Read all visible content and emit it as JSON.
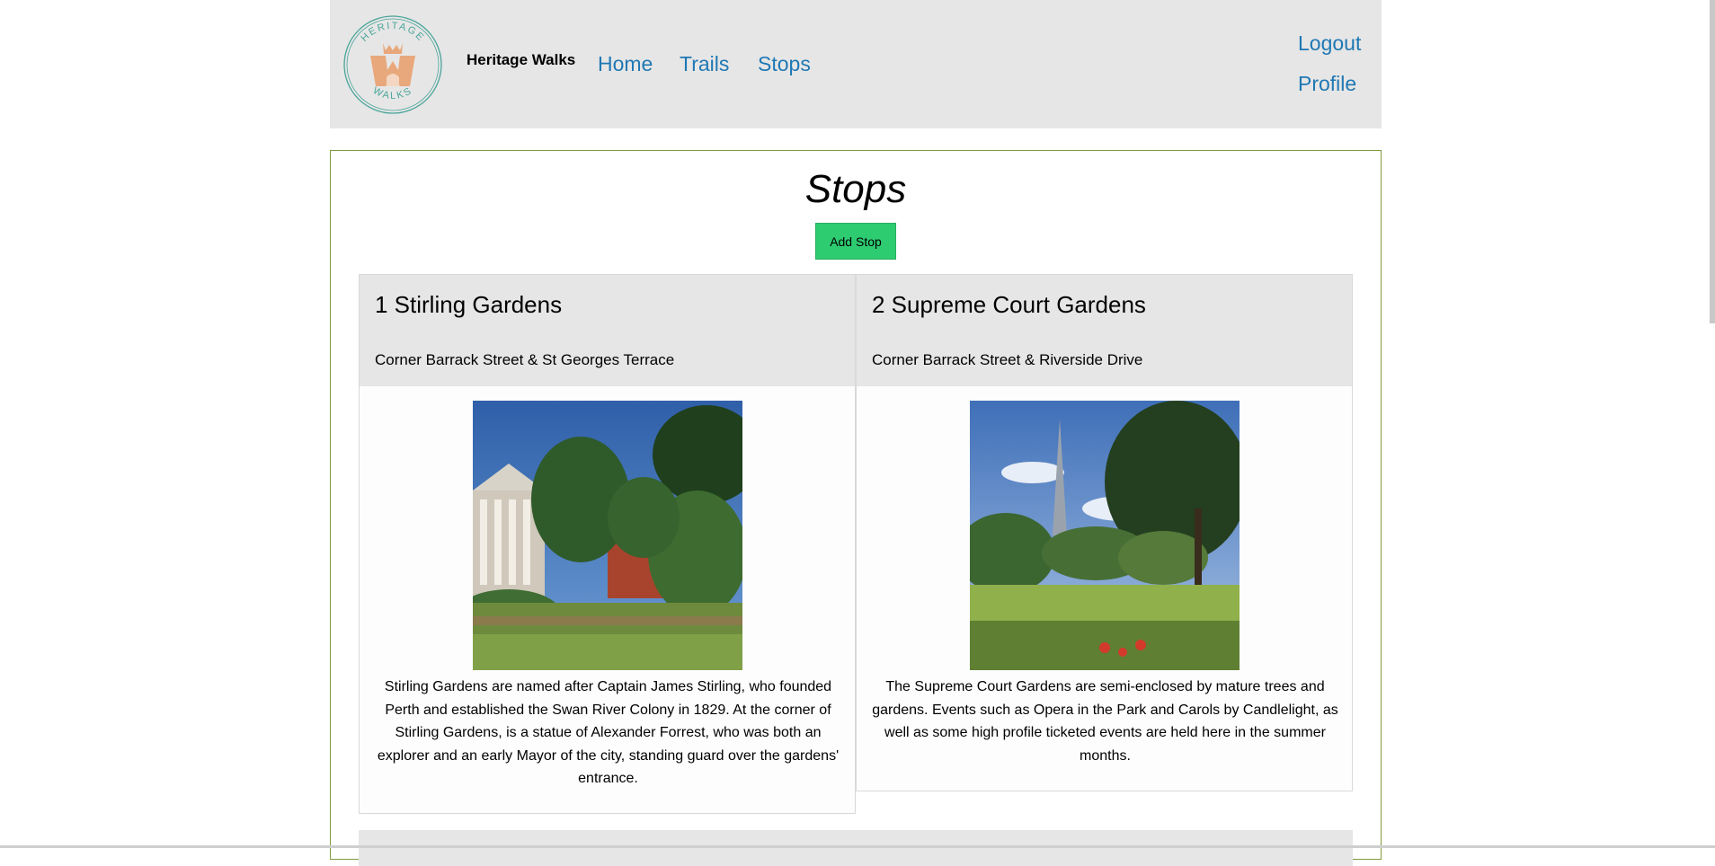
{
  "header": {
    "logo": {
      "top_text": "HERITAGE",
      "bottom_text": "WALKS",
      "ring_color": "#4aa59a",
      "mark_color": "#e8a87c"
    },
    "brand": "Heritage Walks",
    "nav": [
      {
        "label": "Home"
      },
      {
        "label": "Trails"
      },
      {
        "label": "Stops"
      }
    ],
    "user": {
      "logout": "Logout",
      "profile": "Profile"
    },
    "link_color": "#1f78b4"
  },
  "main": {
    "title": "Stops",
    "add_button": "Add Stop",
    "accent_button_color": "#2ecc71",
    "stops": [
      {
        "title": "1 Stirling Gardens",
        "address": "Corner Barrack Street & St Georges Terrace",
        "image_icon": "stirling-gardens-photo",
        "description": "Stirling Gardens are named after Captain James Stirling, who founded Perth and established the Swan River Colony in 1829. At the corner of Stirling Gardens, is a statue of Alexander Forrest, who was both an explorer and an early Mayor of the city, standing guard over the gardens' entrance."
      },
      {
        "title": "2 Supreme Court Gardens",
        "address": "Corner Barrack Street & Riverside Drive",
        "image_icon": "supreme-court-gardens-photo",
        "description": "The Supreme Court Gardens are semi-enclosed by mature trees and gardens. Events such as Opera in the Park and Carols by Candlelight, as well as some high profile ticketed events are held here in the summer months."
      }
    ]
  }
}
